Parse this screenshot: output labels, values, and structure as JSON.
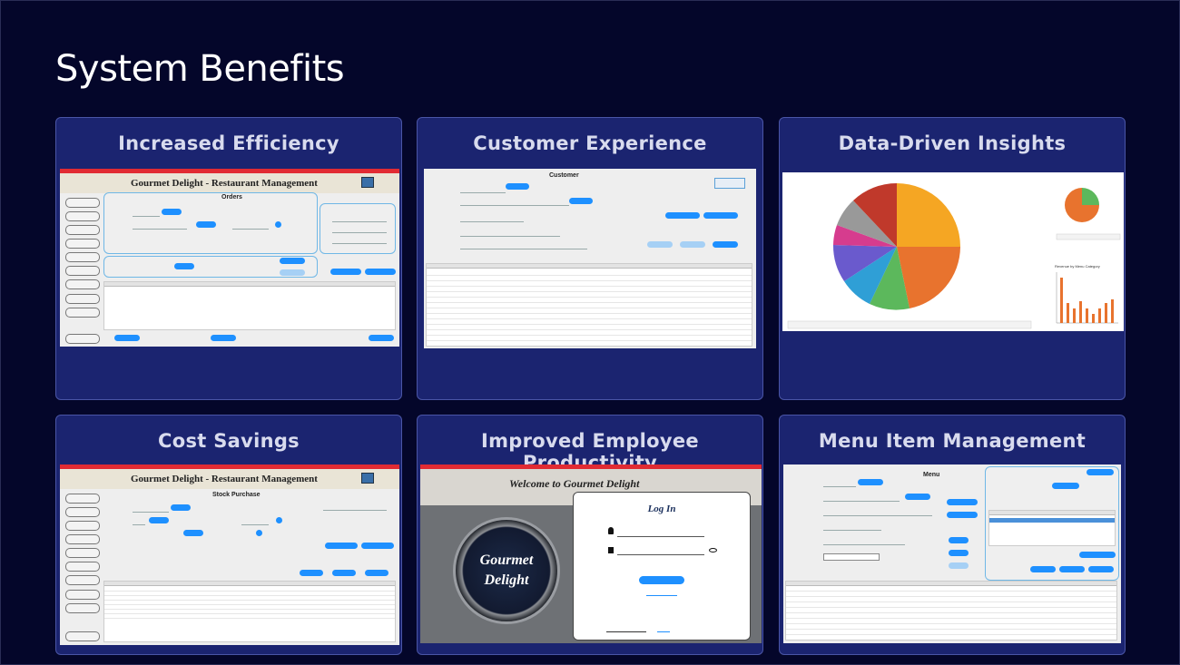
{
  "page": {
    "title": "System Benefits"
  },
  "cards": [
    {
      "title": "Increased Efficiency",
      "screenshot": {
        "app_title": "Gourmet Delight - Restaurant Management",
        "panel": "Orders"
      }
    },
    {
      "title": "Customer Experience",
      "screenshot": {
        "panel": "Customer"
      }
    },
    {
      "title": "Data-Driven Insights",
      "screenshot": {
        "panel": "Revenue by Menu Category"
      }
    },
    {
      "title": "Cost Savings",
      "screenshot": {
        "app_title": "Gourmet Delight - Restaurant Management",
        "panel": "Stock Purchase"
      }
    },
    {
      "title": "Improved Employee Productivity",
      "screenshot": {
        "welcome": "Welcome to Gourmet Delight",
        "login": "Log In",
        "logo_line1": "Gourmet",
        "logo_line2": "Delight"
      }
    },
    {
      "title": "Menu Item Management",
      "screenshot": {
        "panel": "Menu"
      }
    }
  ],
  "colors": {
    "background": "#04062a",
    "card": "#1b2470",
    "card_border": "#4a55a6",
    "title_text": "#d8dbee",
    "accent_blue": "#1e90ff",
    "window_red": "#e12b33"
  },
  "pie_colors": [
    "#f5a623",
    "#e8732e",
    "#5cb85c",
    "#2f9fd6",
    "#6a5acd",
    "#d63c8e",
    "#999999",
    "#c0392b"
  ]
}
